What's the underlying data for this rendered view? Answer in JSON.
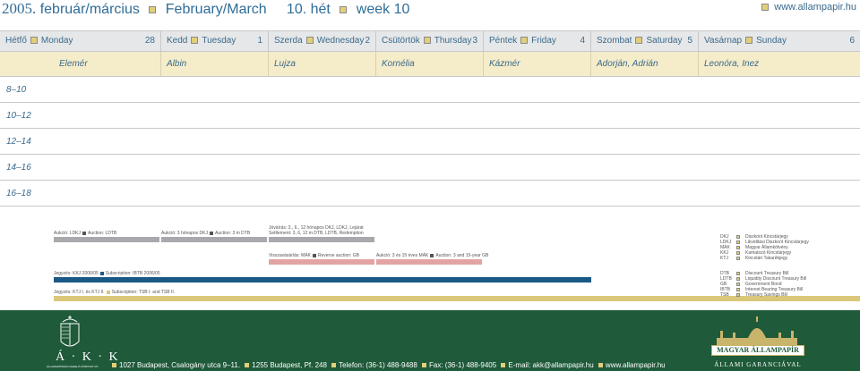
{
  "header": {
    "year": "2005.",
    "months_hu": "február/március",
    "months_en": "February/March",
    "week_hu": "10. hét",
    "week_en": "week 10",
    "website": "www.allampapir.hu"
  },
  "days": [
    {
      "hu": "Hétfő",
      "en": "Monday",
      "num": "28"
    },
    {
      "hu": "Kedd",
      "en": "Tuesday",
      "num": "1"
    },
    {
      "hu": "Szerda",
      "en": "Wednesday",
      "num": "2"
    },
    {
      "hu": "Csütörtök",
      "en": "Thursday",
      "num": "3"
    },
    {
      "hu": "Péntek",
      "en": "Friday",
      "num": "4"
    },
    {
      "hu": "Szombat",
      "en": "Saturday",
      "num": "5"
    },
    {
      "hu": "Vasárnap",
      "en": "Sunday",
      "num": "6"
    }
  ],
  "names": [
    "Elemér",
    "Albin",
    "Lujza",
    "Kornélia",
    "Kázmér",
    "Adorján, Adrián",
    "Leonóra, Inez"
  ],
  "time_slots": [
    "8–10",
    "10–12",
    "12–14",
    "14–16",
    "16–18"
  ],
  "auctions": {
    "mon": {
      "hu": "Aukció: LDKJ",
      "en": "Auction: LDTB"
    },
    "tue": {
      "hu": "Aukció: 3 hónapos DKJ",
      "en": "Auction: 3 m DTB"
    },
    "wed_line1": "Jóváírás: 3., 6., 12 hónapos DKJ, LDKJ, Lejárat",
    "wed_line2": "Settlement: 3, 6, 12 m DTB, LDTB, Redemption",
    "wed_buyback": {
      "hu": "Visszavásárlás: MÁK",
      "en": "Reverse auction: GB"
    },
    "thu": {
      "hu": "Aukció: 3 és 15 éves MÁK",
      "en": "Auction: 3 and 15-year GB"
    },
    "sub1": {
      "hu": "Jegyzés: KKJ 2006/05",
      "en": "Subscription: IBTB 2006/05"
    },
    "sub2": {
      "hu": "Jegyzés: KTJ I. és KTJ II.",
      "en": "Subscription: TSB I. and TSB II."
    }
  },
  "legend": [
    {
      "abbr": "DKJ",
      "text": "Diszkont Kincstárjegy"
    },
    {
      "abbr": "LDKJ",
      "text": "Likviditási Diszkont Kincstárjegy"
    },
    {
      "abbr": "MÁK",
      "text": "Magyar Államkötvény"
    },
    {
      "abbr": "KKJ",
      "text": "Kamatozó Kincstárjegy"
    },
    {
      "abbr": "KTJ",
      "text": "Kincstári Takarékjegy"
    },
    {
      "abbr": "DTB",
      "text": "Discount Treasury Bill"
    },
    {
      "abbr": "LDTB",
      "text": "Liquidity Discount Treasury Bill"
    },
    {
      "abbr": "GB",
      "text": "Government Bond"
    },
    {
      "abbr": "IBTB",
      "text": "Interest Bearing Treasury Bill"
    },
    {
      "abbr": "TSB",
      "text": "Treasury Savings Bill"
    }
  ],
  "footer": {
    "akk_letters": "Á · K · K",
    "akk_sub": "ÁLLAMADÓSSÁG KEZELŐ KÖZPONT RT.",
    "address": "1027 Budapest, Csalogány utca 9–11.",
    "postal": "1255 Budapest, Pf. 248",
    "phone": "Telefon: (36-1) 488-9488",
    "fax": "Fax: (36-1) 488-9405",
    "email": "E-mail: akk@allampapir.hu",
    "web": "www.allampapir.hu",
    "brand_name": "MAGYAR ÁLLAMPAPÍR",
    "brand_tag": "ÁLLAMI GARANCIÁVAL"
  },
  "colors": {
    "brand_blue": "#2f6d97",
    "footer_green": "#1f5a3a",
    "gold": "#dbc779",
    "navy": "#1a5886",
    "pink": "#e3a3a3",
    "gray": "#a7a9ac"
  }
}
